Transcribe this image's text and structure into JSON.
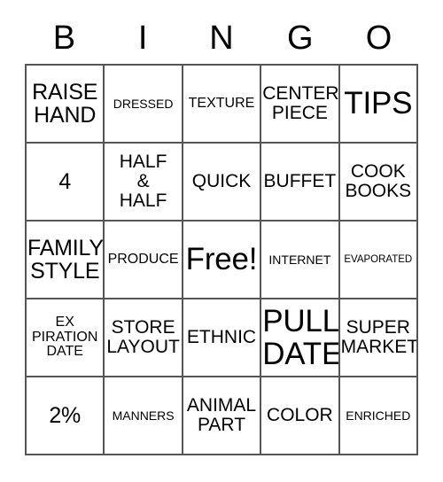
{
  "card": {
    "title": "BINGO",
    "header_letters": [
      "B",
      "I",
      "N",
      "G",
      "O"
    ],
    "border_color": "#555555",
    "background_color": "#ffffff",
    "text_color": "#000000",
    "columns": 5,
    "rows": 5,
    "free_space_label": "Free!",
    "cells": [
      {
        "text": "RAISE\nHAND",
        "size": "lg",
        "row": 1,
        "col": 1
      },
      {
        "text": "DRESSED",
        "size": "xs",
        "row": 1,
        "col": 2
      },
      {
        "text": "TEXTURE",
        "size": "sm",
        "row": 1,
        "col": 3
      },
      {
        "text": "CENTER\nPIECE",
        "size": "md",
        "row": 1,
        "col": 4
      },
      {
        "text": "TIPS",
        "size": "xl",
        "row": 1,
        "col": 5
      },
      {
        "text": "4",
        "size": "lg",
        "row": 2,
        "col": 1
      },
      {
        "text": "HALF\n&\nHALF",
        "size": "md",
        "row": 2,
        "col": 2
      },
      {
        "text": "QUICK",
        "size": "md",
        "row": 2,
        "col": 3
      },
      {
        "text": "BUFFET",
        "size": "md",
        "row": 2,
        "col": 4
      },
      {
        "text": "COOK\nBOOKS",
        "size": "md",
        "row": 2,
        "col": 5
      },
      {
        "text": "FAMILY\nSTYLE",
        "size": "lg",
        "row": 3,
        "col": 1
      },
      {
        "text": "PRODUCE",
        "size": "sm",
        "row": 3,
        "col": 2
      },
      {
        "text": "Free!",
        "size": "xl",
        "row": 3,
        "col": 3
      },
      {
        "text": "INTERNET",
        "size": "xs",
        "row": 3,
        "col": 4
      },
      {
        "text": "EVAPORATED",
        "size": "xxs",
        "row": 3,
        "col": 5
      },
      {
        "text": "EX\nPIRATION\nDATE",
        "size": "sm",
        "row": 4,
        "col": 1
      },
      {
        "text": "STORE\nLAYOUT",
        "size": "md",
        "row": 4,
        "col": 2
      },
      {
        "text": "ETHNIC",
        "size": "md",
        "row": 4,
        "col": 3
      },
      {
        "text": "PULL\nDATE",
        "size": "xl",
        "row": 4,
        "col": 4
      },
      {
        "text": "SUPER\nMARKET",
        "size": "md",
        "row": 4,
        "col": 5
      },
      {
        "text": "2%",
        "size": "lg",
        "row": 5,
        "col": 1
      },
      {
        "text": "MANNERS",
        "size": "xs",
        "row": 5,
        "col": 2
      },
      {
        "text": "ANIMAL\nPART",
        "size": "md",
        "row": 5,
        "col": 3
      },
      {
        "text": "COLOR",
        "size": "md",
        "row": 5,
        "col": 4
      },
      {
        "text": "ENRICHED",
        "size": "xs",
        "row": 5,
        "col": 5
      }
    ]
  }
}
